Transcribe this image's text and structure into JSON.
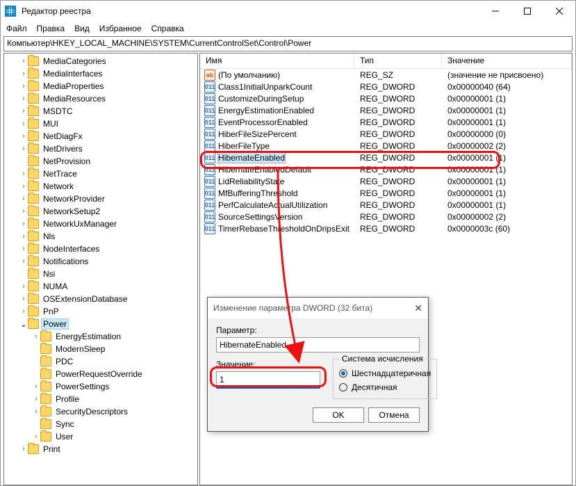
{
  "window": {
    "title": "Редактор реестра"
  },
  "menu": {
    "file": "Файл",
    "edit": "Правка",
    "view": "Вид",
    "fav": "Избранное",
    "help": "Справка"
  },
  "address": "Компьютер\\HKEY_LOCAL_MACHINE\\SYSTEM\\CurrentControlSet\\Control\\Power",
  "tree": {
    "items": [
      {
        "d": 1,
        "c": ">",
        "l": "MediaCategories"
      },
      {
        "d": 1,
        "c": ">",
        "l": "MediaInterfaces"
      },
      {
        "d": 1,
        "c": ">",
        "l": "MediaProperties"
      },
      {
        "d": 1,
        "c": ">",
        "l": "MediaResources"
      },
      {
        "d": 1,
        "c": ">",
        "l": "MSDTC"
      },
      {
        "d": 1,
        "c": ">",
        "l": "MUI"
      },
      {
        "d": 1,
        "c": ">",
        "l": "NetDiagFx"
      },
      {
        "d": 1,
        "c": ">",
        "l": "NetDrivers"
      },
      {
        "d": 1,
        "c": "",
        "l": "NetProvision"
      },
      {
        "d": 1,
        "c": ">",
        "l": "NetTrace"
      },
      {
        "d": 1,
        "c": ">",
        "l": "Network"
      },
      {
        "d": 1,
        "c": ">",
        "l": "NetworkProvider"
      },
      {
        "d": 1,
        "c": ">",
        "l": "NetworkSetup2"
      },
      {
        "d": 1,
        "c": ">",
        "l": "NetworkUxManager"
      },
      {
        "d": 1,
        "c": ">",
        "l": "Nls"
      },
      {
        "d": 1,
        "c": ">",
        "l": "NodeInterfaces"
      },
      {
        "d": 1,
        "c": ">",
        "l": "Notifications"
      },
      {
        "d": 1,
        "c": "",
        "l": "Nsi"
      },
      {
        "d": 1,
        "c": ">",
        "l": "NUMA"
      },
      {
        "d": 1,
        "c": ">",
        "l": "OSExtensionDatabase"
      },
      {
        "d": 1,
        "c": ">",
        "l": "PnP"
      },
      {
        "d": 1,
        "c": "v",
        "l": "Power",
        "sel": true
      },
      {
        "d": 2,
        "c": ">",
        "l": "EnergyEstimation"
      },
      {
        "d": 2,
        "c": "",
        "l": "ModernSleep"
      },
      {
        "d": 2,
        "c": "",
        "l": "PDC"
      },
      {
        "d": 2,
        "c": "",
        "l": "PowerRequestOverride"
      },
      {
        "d": 2,
        "c": ">",
        "l": "PowerSettings"
      },
      {
        "d": 2,
        "c": ">",
        "l": "Profile"
      },
      {
        "d": 2,
        "c": ">",
        "l": "SecurityDescriptors"
      },
      {
        "d": 2,
        "c": "",
        "l": "Sync"
      },
      {
        "d": 2,
        "c": ">",
        "l": "User"
      },
      {
        "d": 1,
        "c": ">",
        "l": "Print"
      }
    ]
  },
  "columns": {
    "name": "Имя",
    "type": "Тип",
    "data": "Значение"
  },
  "values": [
    {
      "icon": "str",
      "name": "(По умолчанию)",
      "type": "REG_SZ",
      "data": "(значение не присвоено)"
    },
    {
      "icon": "bin",
      "name": "Class1InitialUnparkCount",
      "type": "REG_DWORD",
      "data": "0x00000040 (64)"
    },
    {
      "icon": "bin",
      "name": "CustomizeDuringSetup",
      "type": "REG_DWORD",
      "data": "0x00000001 (1)"
    },
    {
      "icon": "bin",
      "name": "EnergyEstimationEnabled",
      "type": "REG_DWORD",
      "data": "0x00000001 (1)"
    },
    {
      "icon": "bin",
      "name": "EventProcessorEnabled",
      "type": "REG_DWORD",
      "data": "0x00000001 (1)"
    },
    {
      "icon": "bin",
      "name": "HiberFileSizePercent",
      "type": "REG_DWORD",
      "data": "0x00000000 (0)"
    },
    {
      "icon": "bin",
      "name": "HiberFileType",
      "type": "REG_DWORD",
      "data": "0x00000002 (2)"
    },
    {
      "icon": "bin",
      "name": "HibernateEnabled",
      "type": "REG_DWORD",
      "data": "0x00000001 (1)",
      "sel": true
    },
    {
      "icon": "bin",
      "name": "HibernateEnabledDefault",
      "type": "REG_DWORD",
      "data": "0x00000001 (1)"
    },
    {
      "icon": "bin",
      "name": "LidReliabilityState",
      "type": "REG_DWORD",
      "data": "0x00000001 (1)"
    },
    {
      "icon": "bin",
      "name": "MfBufferingThreshold",
      "type": "REG_DWORD",
      "data": "0x00000001 (1)"
    },
    {
      "icon": "bin",
      "name": "PerfCalculateActualUtilization",
      "type": "REG_DWORD",
      "data": "0x00000001 (1)"
    },
    {
      "icon": "bin",
      "name": "SourceSettingsVersion",
      "type": "REG_DWORD",
      "data": "0x00000002 (2)"
    },
    {
      "icon": "bin",
      "name": "TimerRebaseThresholdOnDripsExit",
      "type": "REG_DWORD",
      "data": "0x0000003c (60)"
    }
  ],
  "dialog": {
    "title": "Изменение параметра DWORD (32 бита)",
    "param_label": "Параметр:",
    "param_value": "HibernateEnabled",
    "value_label": "Значение:",
    "value": "1",
    "base_legend": "Система исчисления",
    "radio_hex": "Шестнадцатеричная",
    "radio_dec": "Десятичная",
    "ok": "OK",
    "cancel": "Отмена"
  }
}
